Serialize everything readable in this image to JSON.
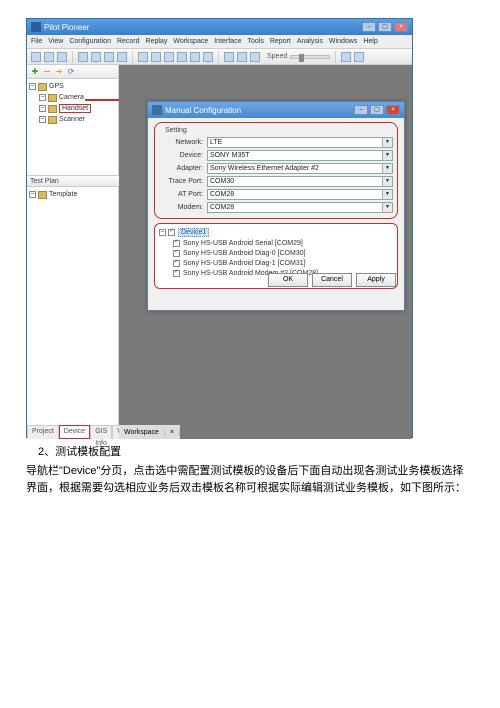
{
  "app_title": "Pilot Pioneer",
  "menu": [
    "File",
    "View",
    "Configuration",
    "Record",
    "Replay",
    "Workspace",
    "Interface",
    "Tools",
    "Report",
    "Analysis",
    "Windows",
    "Help"
  ],
  "toolbar_speed_label": "Speed",
  "tree": {
    "items": [
      "GPS",
      "Camera",
      "Handset",
      "Scanner"
    ],
    "selected_index": 2
  },
  "testplan": {
    "header": "Test Plan",
    "item": "Template"
  },
  "bottom_tabs": [
    "Project",
    "Device",
    "GIS Info",
    "Workspace"
  ],
  "bottom_active_index": 1,
  "canvas_tab": "Workspace",
  "dialog": {
    "title": "Manual Configuration",
    "group_label": "Setting",
    "fields": [
      {
        "label": "Network:",
        "value": "LTE"
      },
      {
        "label": "Device:",
        "value": "SONY M35T"
      },
      {
        "label": "Adapter:",
        "value": "Sony Wireless Ethernet Adapter #2"
      },
      {
        "label": "Trace Port:",
        "value": "COM30"
      },
      {
        "label": "AT Port:",
        "value": "COM28"
      },
      {
        "label": "Modem:",
        "value": "COM28"
      }
    ],
    "device_header": "Device1",
    "device_list": [
      "Sony HS-USB Android Serial [COM29]",
      "Sony HS-USB Android Diag-0 [COM30]",
      "Sony HS-USB Android Diag-1 [COM31]",
      "Sony HS-USB Android Modem #2 [COM28]"
    ],
    "buttons": [
      "OK",
      "Cancel",
      "Apply"
    ]
  },
  "doc": {
    "heading": "2、测试模板配置",
    "paragraph": "导航栏\"Device\"分页，点击选中需配置测试模板的设备后下面自动出现各测试业务模板选择界面，根据需要勾选相应业务后双击模板名称可根据实际编辑测试业务模板，如下图所示："
  }
}
